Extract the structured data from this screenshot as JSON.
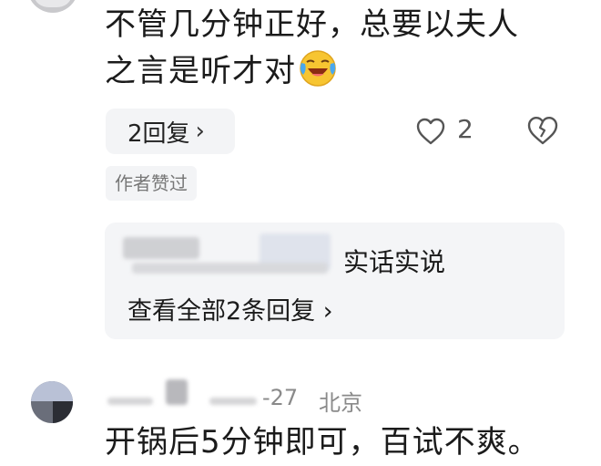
{
  "comment1": {
    "text_line1": "不管几分钟正好，总要以夫人",
    "text_line2": "之言是听才对",
    "emoji": "laughing-crying-emoji",
    "replies_label": "2回复",
    "like_count": "2",
    "author_liked_badge": "作者赞过"
  },
  "reply_preview": {
    "reply_text": "实话实说",
    "view_all_label": "查看全部2条回复"
  },
  "comment2": {
    "date": "-27",
    "location": "北京",
    "text": "开锅后5分钟即可，百试不爽。"
  },
  "colors": {
    "text": "#1b1b1b",
    "muted": "#8a8a8a",
    "pill_bg": "#f3f4f6",
    "icon": "#555555"
  }
}
